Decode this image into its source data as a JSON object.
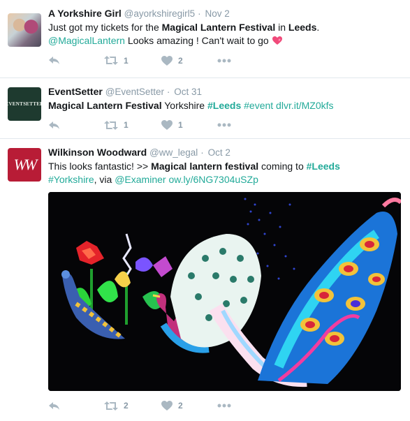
{
  "tweets": [
    {
      "name": "A Yorkshire Girl",
      "handle": "@ayorkshiregirl5",
      "sep": "·",
      "time": "Nov 2",
      "text": {
        "p1": "Just got my tickets for the ",
        "b1": "Magical Lantern Festival",
        "p2": " in ",
        "b2": "Leeds",
        "p3": ".",
        "mention": "@MagicalLantern",
        "p4": " Looks amazing ! Can't wait to go "
      },
      "emoji": "heart-emoji",
      "retweets": "1",
      "likes": "2"
    },
    {
      "name": "EventSetter",
      "handle": "@EventSetter",
      "sep": "·",
      "time": "Oct 31",
      "avatar_text": "EVENTSETTER",
      "text": {
        "b1": "Magical Lantern Festival",
        "p1": " Yorkshire ",
        "hash1": "#Leeds",
        "hash2": " #event",
        "link": " dlvr.it/MZ0kfs"
      },
      "retweets": "1",
      "likes": "1"
    },
    {
      "name": "Wilkinson Woodward",
      "handle": "@ww_legal",
      "sep": "·",
      "time": "Oct 2",
      "avatar_text": "WW",
      "text": {
        "p1": "This looks fantastic! >> ",
        "b1": "Magical lantern festival",
        "p2": " coming to ",
        "hash1": "#Leeds",
        "hash2": "#Yorkshire",
        "p3": ", via ",
        "mention": "@Examiner",
        "link": " ow.ly/6NG7304uSZp"
      },
      "media": "peacock-lanterns-photo",
      "retweets": "2",
      "likes": "2"
    }
  ],
  "icons": {
    "reply": "reply-icon",
    "retweet": "retweet-icon",
    "like": "heart-icon",
    "more": "more-icon"
  },
  "colors": {
    "link": "#22aa99",
    "muted": "#8899a6",
    "icon": "#aab8c2",
    "divider": "#e1e8ed"
  }
}
